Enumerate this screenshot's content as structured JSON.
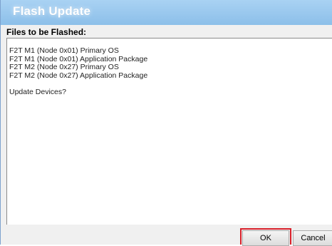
{
  "window": {
    "title": "Flash Update"
  },
  "section": {
    "header": "Files to be Flashed:"
  },
  "content": {
    "lines": [
      "F2T M1 (Node 0x01) Primary OS",
      "F2T M1 (Node 0x01) Application Package",
      "F2T M2 (Node 0x27) Primary OS",
      "F2T M2 (Node 0x27) Application Package"
    ],
    "prompt": "Update Devices?"
  },
  "buttons": {
    "ok_label": "OK",
    "cancel_label": "Cancel"
  },
  "colors": {
    "title_bar": "#8cbfe9",
    "highlight": "#d8202a"
  }
}
